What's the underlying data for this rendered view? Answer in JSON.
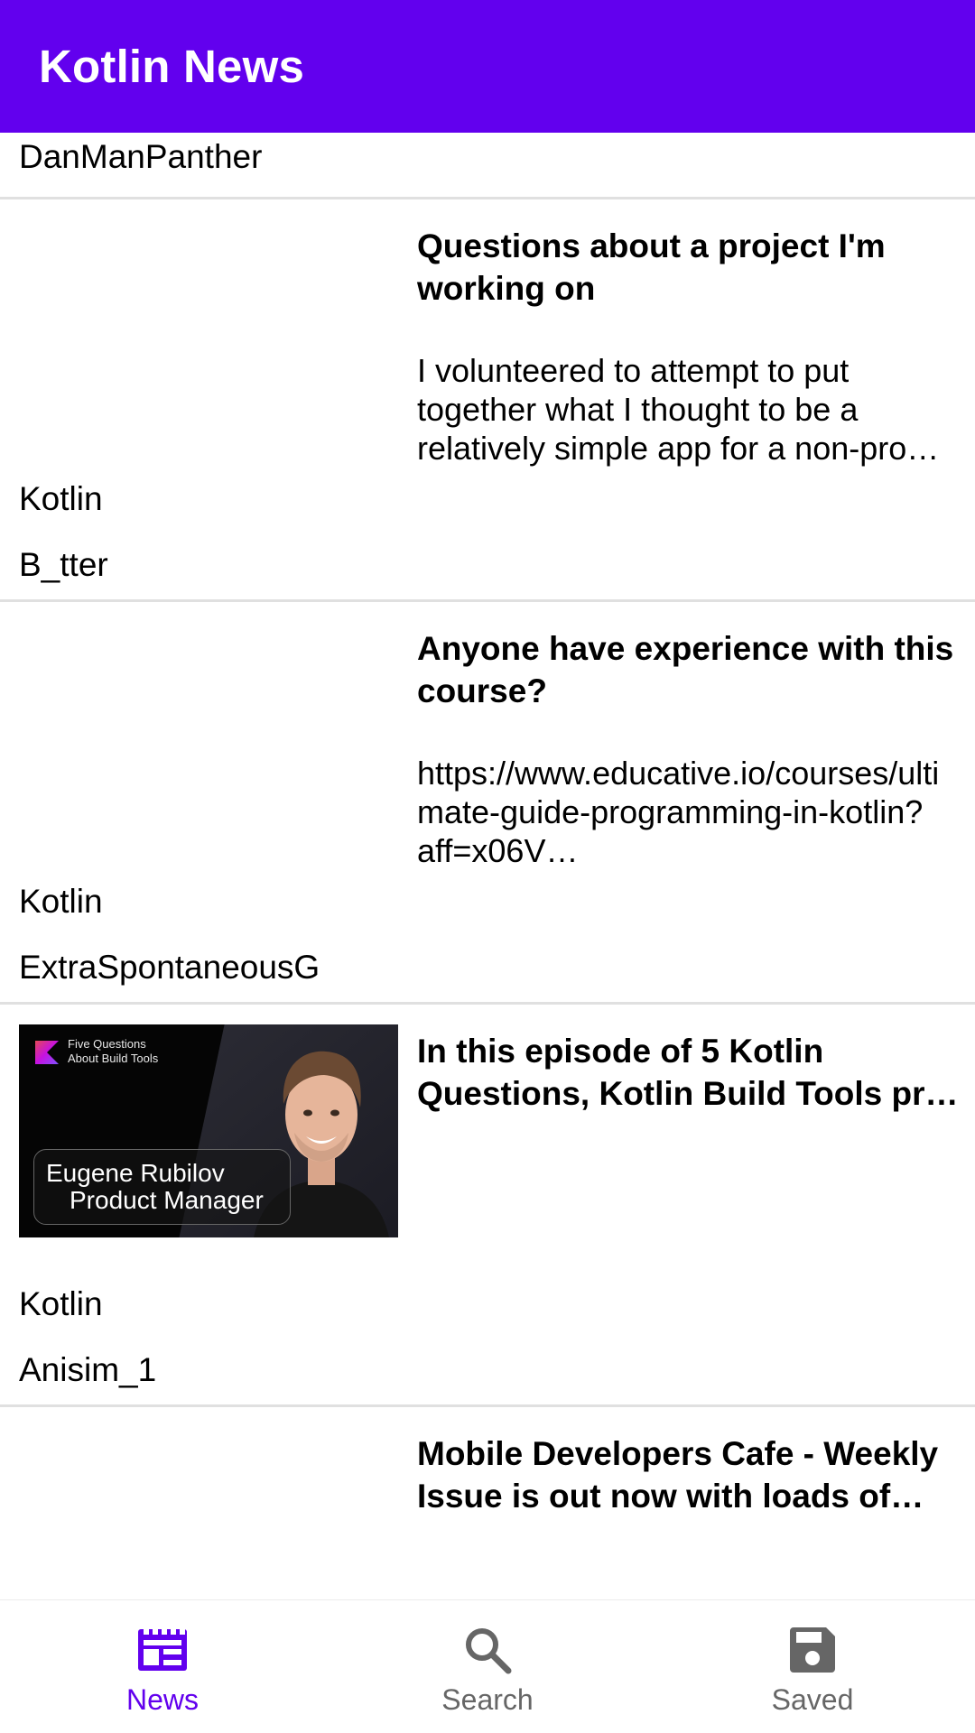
{
  "app": {
    "title": "Kotlin News"
  },
  "feed": {
    "partial_top_author": "DanManPanther",
    "items": [
      {
        "title": "Questions about a project I'm working on",
        "body": "I volunteered to attempt to put together what I thought to be a relatively simple app for a non-pro…",
        "subreddit": "Kotlin",
        "author": "B_tter",
        "has_thumbnail": false
      },
      {
        "title": "Anyone have experience with this course?",
        "body": "https://www.educative.io/courses/ultimate-guide-programming-in-kotlin?aff=x06V…",
        "subreddit": "Kotlin",
        "author": "ExtraSpontaneousG",
        "has_thumbnail": false
      },
      {
        "title": "In this episode of 5 Kotlin Questions, Kotlin Build Tools pr…",
        "body": "",
        "subreddit": "Kotlin",
        "author": "Anisim_1",
        "has_thumbnail": true,
        "thumbnail": {
          "caption_line1": "Five Questions",
          "caption_line2": "About Build Tools",
          "name_line1": "Eugene Rubilov",
          "name_line2": "Product Manager"
        }
      },
      {
        "title": "Mobile Developers Cafe - Weekly Issue is out now with loads of M…",
        "body": "",
        "subreddit": "",
        "author": "",
        "has_thumbnail": false
      }
    ]
  },
  "bottom_nav": {
    "items": [
      {
        "label": "News",
        "icon": "news-icon",
        "active": true
      },
      {
        "label": "Search",
        "icon": "search-icon",
        "active": false
      },
      {
        "label": "Saved",
        "icon": "save-icon",
        "active": false
      }
    ]
  },
  "colors": {
    "primary": "#6200EE",
    "inactive": "#666666",
    "divider": "#e0e0e0"
  }
}
